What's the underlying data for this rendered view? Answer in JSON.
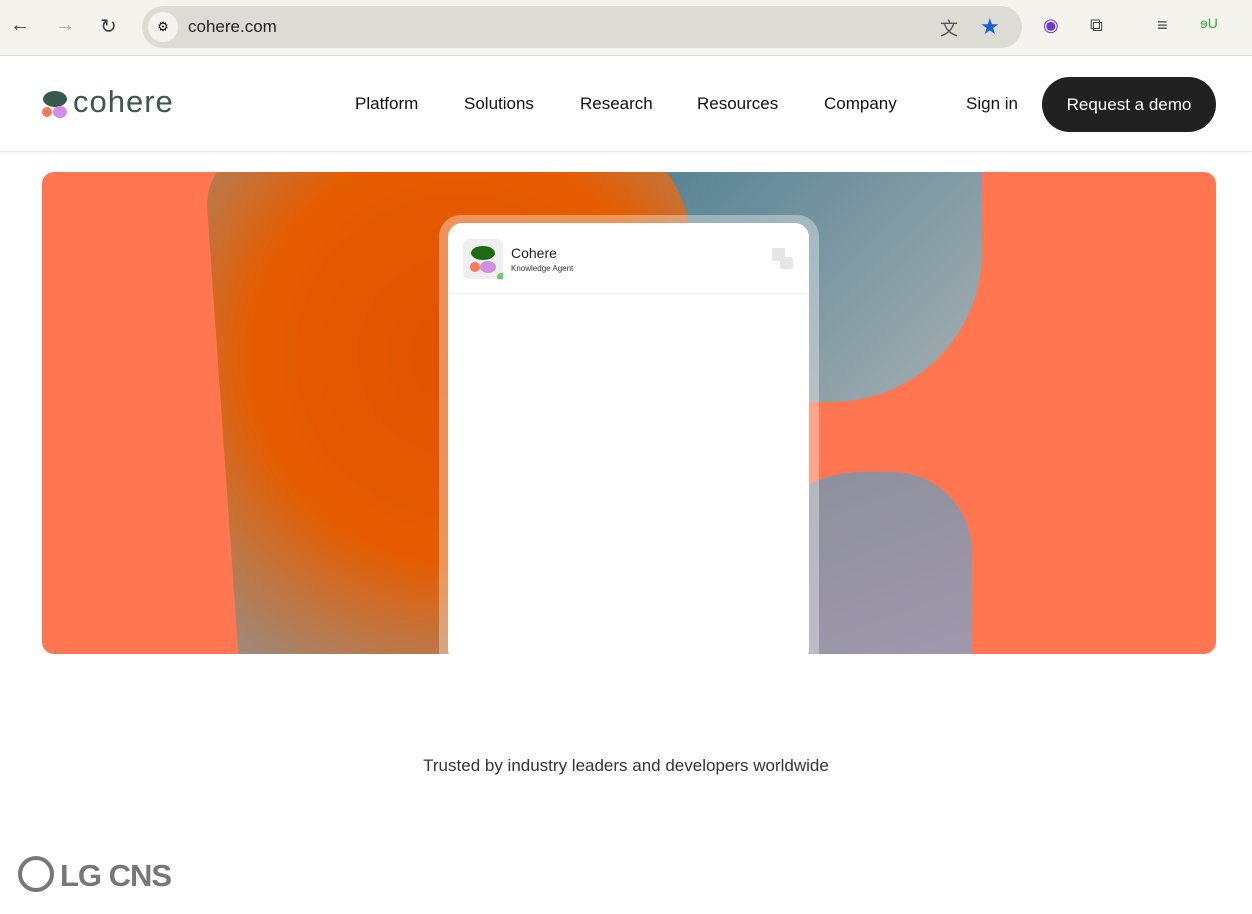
{
  "browser": {
    "url": "cohere.com"
  },
  "site": {
    "logo": "cohere",
    "nav": [
      "Platform",
      "Solutions",
      "Research",
      "Resources",
      "Company"
    ],
    "sign_in": "Sign in",
    "cta": "Request a demo"
  },
  "hero": {
    "agent_name": "Cohere",
    "agent_subtitle": "Knowledge Agent"
  },
  "trusted": "Trusted by industry leaders and developers worldwide",
  "customer_logo": "LG CNS",
  "colors": {
    "hero_bg": "#ff7650",
    "cta_bg": "#212121",
    "logo_green": "#39594d"
  }
}
